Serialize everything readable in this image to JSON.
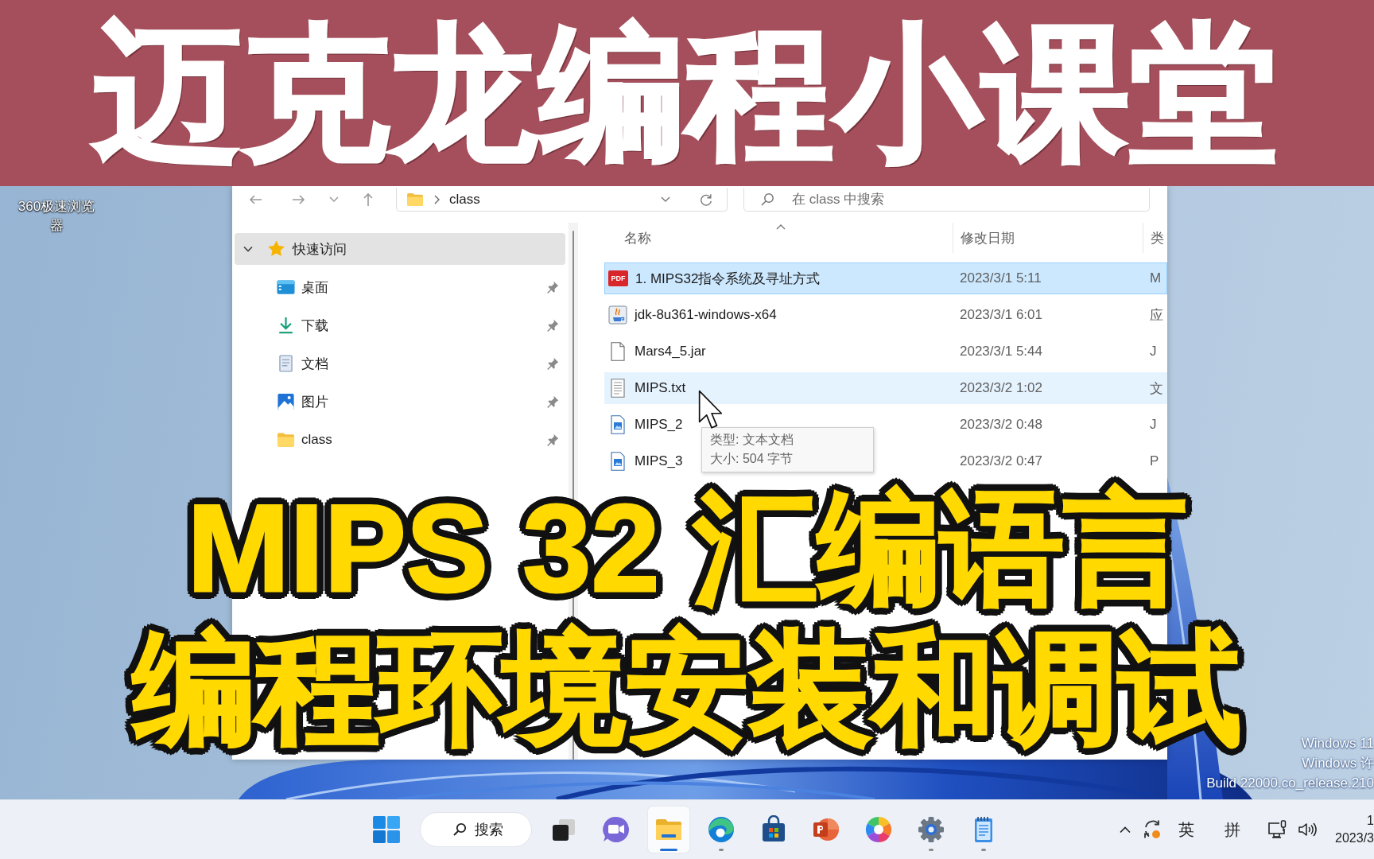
{
  "banner": {
    "title": "迈克龙编程小课堂"
  },
  "desktop": {
    "icons": [
      {
        "label": "360极速浏览器"
      }
    ],
    "activation_notice": [
      "Windows 11",
      "Windows 许",
      "Build 22000.co_release.210"
    ]
  },
  "explorer": {
    "toolbar": {
      "path": [
        "class"
      ],
      "search": {
        "placeholder": "在 class 中搜索"
      }
    },
    "navigation": [
      {
        "label": "快速访问",
        "kind": "quick-access",
        "expanded": true,
        "selected": true,
        "children": [
          {
            "label": "桌面",
            "kind": "desktop",
            "pinned": true
          },
          {
            "label": "下载",
            "kind": "downloads",
            "pinned": true
          },
          {
            "label": "文档",
            "kind": "documents",
            "pinned": true
          },
          {
            "label": "图片",
            "kind": "pictures",
            "pinned": true
          },
          {
            "label": "class",
            "kind": "folder",
            "pinned": true
          }
        ]
      }
    ],
    "columns": [
      {
        "label": "名称",
        "sorted": true
      },
      {
        "label": "修改日期",
        "sorted": false
      },
      {
        "label": "类",
        "sorted": false
      }
    ],
    "rows": [
      {
        "name": "1. MIPS32指令系统及寻址方式",
        "kind": "pdf",
        "icon_text": "PDF",
        "modified": "2023/3/1 5:11",
        "column_3": "M",
        "selected": true,
        "hovered": false
      },
      {
        "name": "jdk-8u361-windows-x64",
        "kind": "installer",
        "modified": "2023/3/1 6:01",
        "column_3": "应",
        "selected": false,
        "hovered": false
      },
      {
        "name": "Mars4_5.jar",
        "kind": "file",
        "modified": "2023/3/1 5:44",
        "column_3": "J",
        "selected": false,
        "hovered": false
      },
      {
        "name": "MIPS.txt",
        "kind": "text",
        "modified": "2023/3/2 1:02",
        "column_3": "文",
        "selected": false,
        "hovered": true
      },
      {
        "name": "MIPS_2",
        "kind": "image",
        "modified": "2023/3/2 0:48",
        "column_3": "J",
        "selected": false,
        "hovered": false
      },
      {
        "name": "MIPS_3",
        "kind": "image",
        "modified": "2023/3/2 0:47",
        "column_3": "P",
        "selected": false,
        "hovered": false
      }
    ],
    "tooltip": [
      "类型: 文本文档",
      "大小: 504 字节"
    ]
  },
  "caption": [
    "MIPS 32 汇编语言",
    "编程环境安装和调试"
  ],
  "taskbar": {
    "search": {
      "label": "搜索"
    },
    "apps": [
      {
        "kind": "task-view",
        "running": false,
        "active": false
      },
      {
        "kind": "chat",
        "running": false,
        "active": false
      },
      {
        "kind": "explorer",
        "running": true,
        "active": true
      },
      {
        "kind": "browser",
        "running": true,
        "active": false
      },
      {
        "kind": "store",
        "running": false,
        "active": false
      },
      {
        "kind": "presentation",
        "running": false,
        "active": false
      },
      {
        "kind": "photos",
        "running": false,
        "active": false
      },
      {
        "kind": "settings",
        "running": true,
        "active": false
      },
      {
        "kind": "notepad",
        "running": true,
        "active": false
      }
    ],
    "tray": {
      "input_language": "英",
      "input_method": "拼",
      "clock": {
        "time": "1",
        "date": "2023/3"
      }
    }
  }
}
